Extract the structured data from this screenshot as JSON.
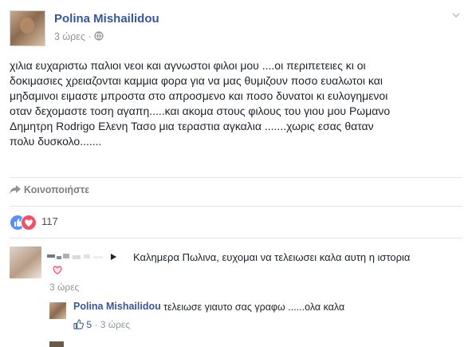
{
  "post": {
    "author": "Polina Mishailidou",
    "time": "3 ώρες",
    "separator": "·",
    "privacy_icon": "globe-icon",
    "menu_icon": "chevron-down-icon",
    "text_lines": [
      "χιλια ευχαριστω παλιοι νεοι και αγνωστοι φιλοι μου ....οι περιπετειες κι οι",
      "δοκιμασιες χρειαζονται καμμια φορα για να μας θυμιζουν ποσο ευαλωτοι και",
      "μηδαμινοι ειμαστε μπροστα στο απροσμενο και ποσο δυνατοι κι ευλογημενοι",
      "οταν δεχομαστε τοση αγαπη.....και ακομα στους φιλους του γιου μου Ρωμανο",
      "Δημητρη Rodrigo Ελενη Τασο μια τεραστια αγκαλια .......χωρις εσας θαταν",
      "πολυ δυσκολο......."
    ],
    "share_label": "Κοινοποιήστε",
    "reaction_count": "117",
    "reaction_icons": [
      "like-icon",
      "love-icon"
    ]
  },
  "comments": [
    {
      "text": "Καλημερα Πωλινα, ευχομαι να τελειωσει καλα αυτη η ιστορια",
      "reaction_icon": "love-icon",
      "time": "3 ώρες",
      "replies": [
        {
          "author": "Polina Mishailidou",
          "text": "τελειωσε γιαυτο σας γραφω ......ολα καλα",
          "likes": "5",
          "separator": "·",
          "time": "3 ώρες"
        }
      ]
    }
  ],
  "colors": {
    "link": "#365899",
    "meta": "#90949c",
    "like": "#5890ff",
    "love": "#f25268"
  }
}
